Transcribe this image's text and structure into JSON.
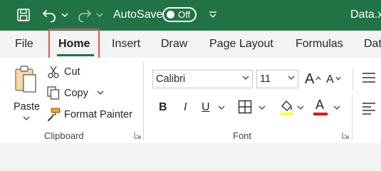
{
  "titlebar": {
    "autosave_label": "AutoSave",
    "autosave_state": "Off",
    "filename": "Data.xlsx",
    "background": "#217346"
  },
  "tabs": {
    "file": "File",
    "home": "Home",
    "insert": "Insert",
    "draw": "Draw",
    "page_layout": "Page Layout",
    "formulas": "Formulas",
    "data": "Data",
    "active": "Home",
    "highlight_color": "#e6504f"
  },
  "clipboard": {
    "paste_label": "Paste",
    "cut_label": "Cut",
    "copy_label": "Copy",
    "format_painter_label": "Format Painter",
    "group_label": "Clipboard"
  },
  "font": {
    "font_name": "Calibri",
    "font_size": "11",
    "bold": "B",
    "italic": "I",
    "underline": "U",
    "font_color_glyph": "A",
    "grow_glyph": "A",
    "shrink_glyph": "A",
    "font_color_accent": "#e81123",
    "group_label": "Font"
  }
}
